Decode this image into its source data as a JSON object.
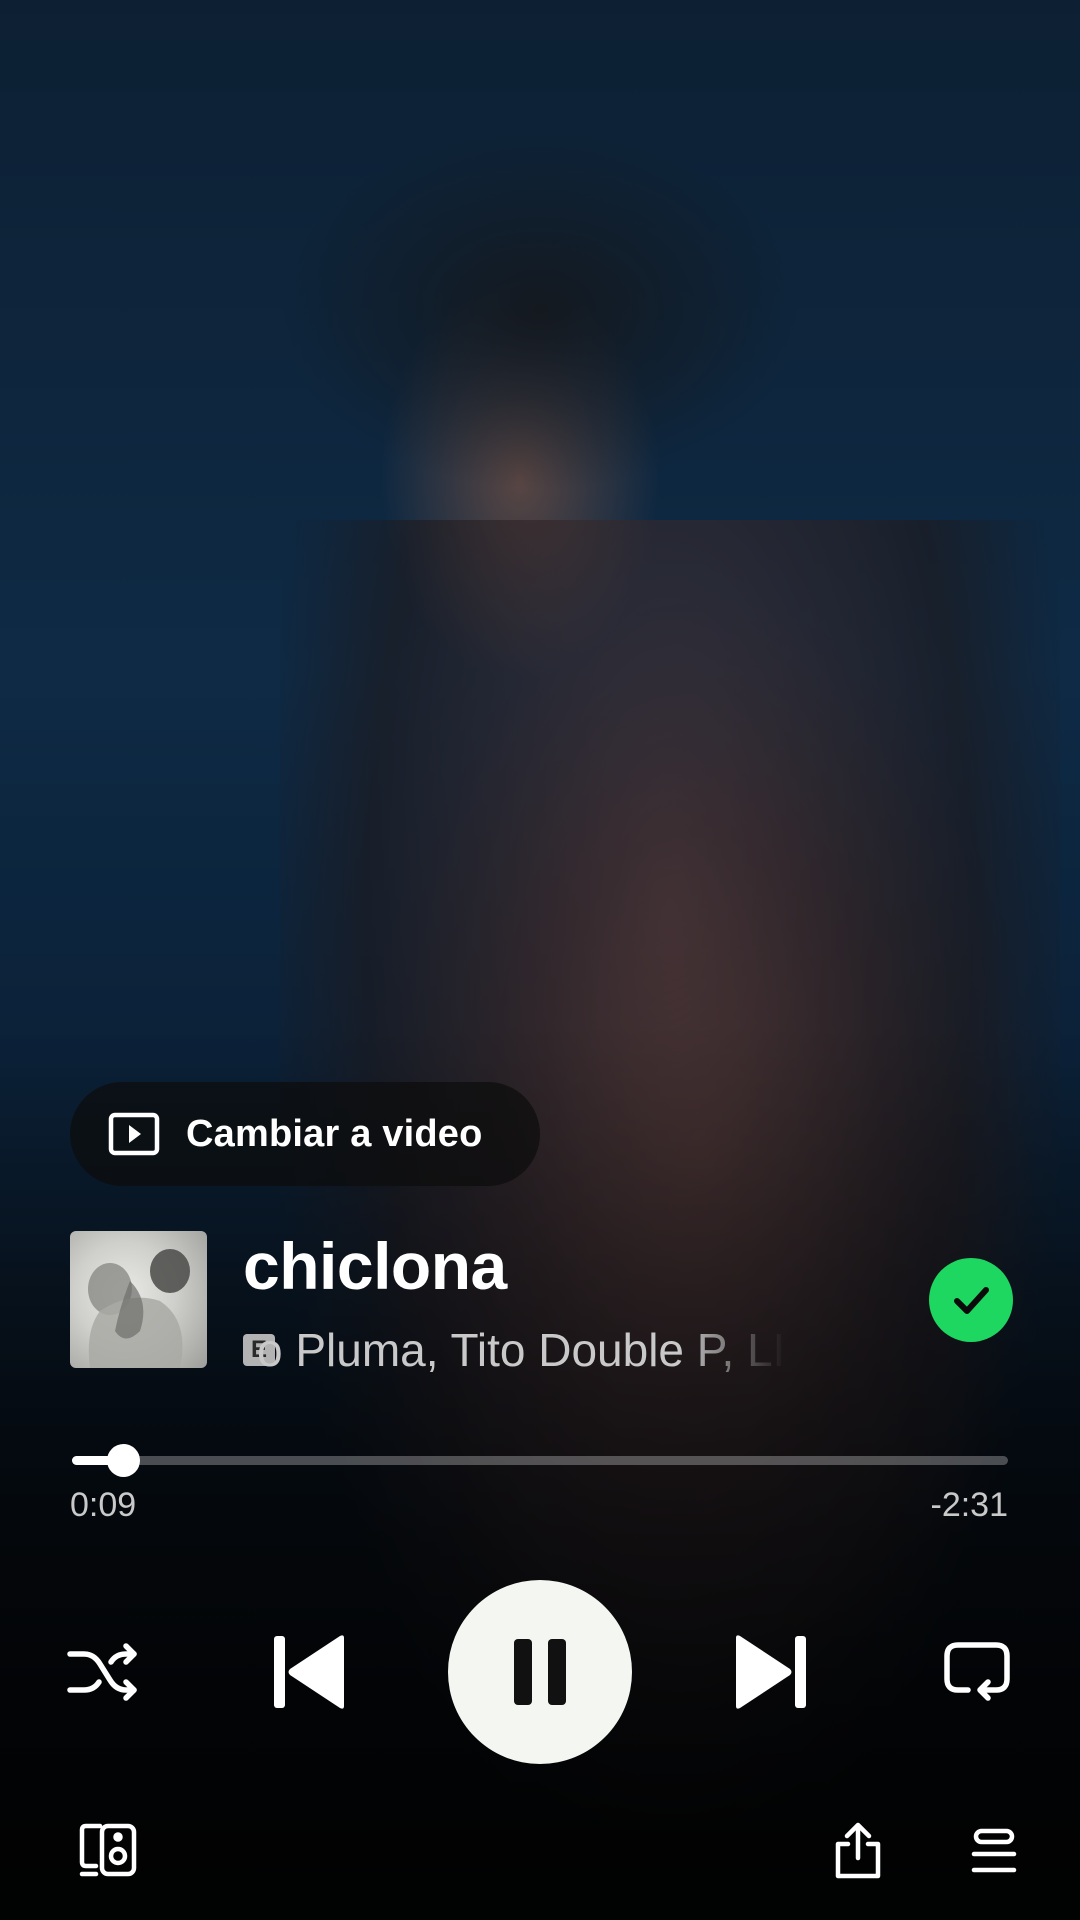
{
  "video_toggle": {
    "label": "Cambiar a video",
    "icon": "play-square-icon"
  },
  "track": {
    "title": "chiclona",
    "explicit_badge": "E",
    "artists": "Yo Pluma, Tito Double P, LINO",
    "artists_visible": "o Pluma, Tito Double P, LI",
    "saved": true
  },
  "playback": {
    "elapsed": "0:09",
    "remaining": "-2:31",
    "progress_fraction": 0.056,
    "state": "playing"
  },
  "controls": {
    "shuffle": "shuffle-icon",
    "previous": "skip-previous-icon",
    "play_pause": "pause-icon",
    "next": "skip-next-icon",
    "repeat": "repeat-icon"
  },
  "bottom_bar": {
    "devices": "connect-devices-icon",
    "share": "share-icon",
    "queue": "queue-icon"
  },
  "colors": {
    "accent": "#1ed760",
    "play_button": "#f4f6f2",
    "secondary_text": "#c9c9c9"
  }
}
